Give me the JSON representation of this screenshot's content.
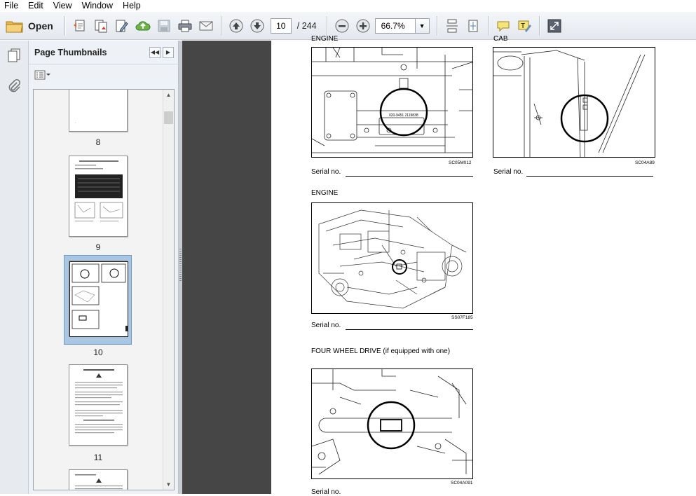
{
  "menu": [
    "File",
    "Edit",
    "View",
    "Window",
    "Help"
  ],
  "toolbar": {
    "open_label": "Open",
    "current_page": "10",
    "page_count": "/ 244",
    "zoom": "66.7%"
  },
  "panel": {
    "title": "Page Thumbnails",
    "thumbnails": [
      {
        "label": "8"
      },
      {
        "label": "9"
      },
      {
        "label": "10",
        "selected": true
      },
      {
        "label": "11"
      }
    ]
  },
  "document": {
    "top_left_heading": "ENGINE",
    "top_right_heading": "CAB",
    "fig1_code": "SC05M012",
    "fig1_plate": "020-9451 2119838",
    "fig2_code": "SC04A89",
    "serial_label": "Serial no.",
    "mid_heading": "ENGINE",
    "fig3_code": "SS07F185",
    "bottom_heading": "FOUR WHEEL DRIVE (if equipped with one)",
    "fig4_code": "SC04A091",
    "bottom_serial_label": "Serial no."
  }
}
